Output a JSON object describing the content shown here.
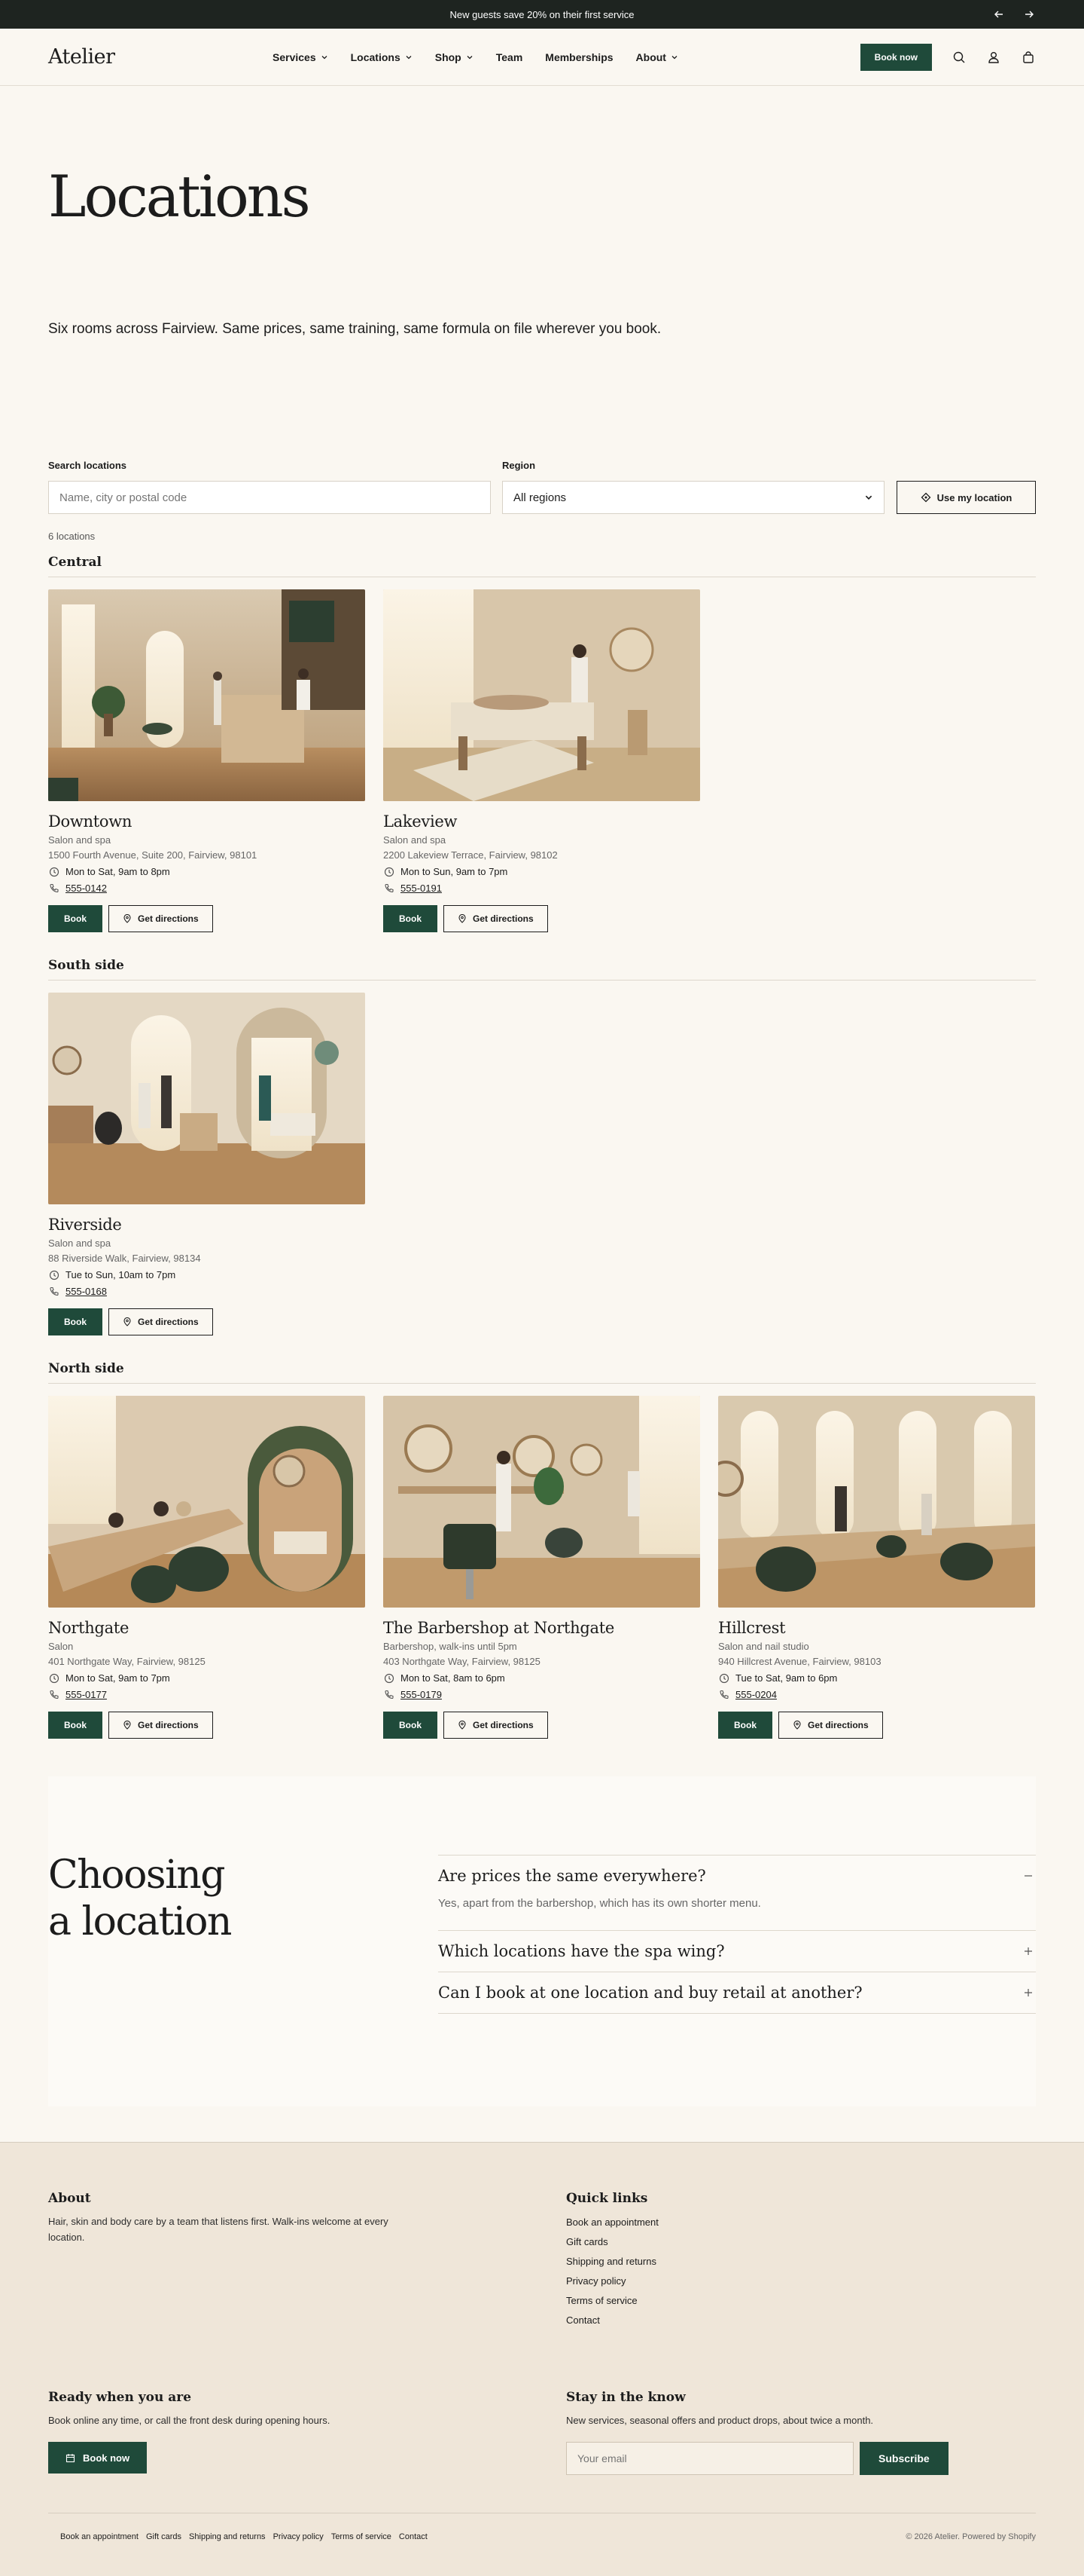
{
  "announcement": {
    "text": "New guests save 20% on their first service"
  },
  "header": {
    "logo": "Atelier",
    "nav": [
      {
        "label": "Services",
        "dropdown": true
      },
      {
        "label": "Locations",
        "dropdown": true
      },
      {
        "label": "Shop",
        "dropdown": true
      },
      {
        "label": "Team",
        "dropdown": false
      },
      {
        "label": "Memberships",
        "dropdown": false
      },
      {
        "label": "About",
        "dropdown": true
      }
    ],
    "book_label": "Book now"
  },
  "hero": {
    "title": "Locations",
    "subtitle": "Six rooms across Fairview. Same prices, same training, same formula on file wherever you book."
  },
  "search": {
    "search_label": "Search locations",
    "search_placeholder": "Name, city or postal code",
    "region_label": "Region",
    "region_value": "All regions",
    "use_location_label": "Use my location",
    "count": "6 locations"
  },
  "groups": [
    {
      "title": "Central",
      "locations": [
        {
          "name": "Downtown",
          "type": "Salon and spa",
          "address": "1500 Fourth Avenue, Suite 200, Fairview, 98101",
          "hours": "Mon to Sat, 9am to 8pm",
          "phone": "555-0142"
        },
        {
          "name": "Lakeview",
          "type": "Salon and spa",
          "address": "2200 Lakeview Terrace, Fairview, 98102",
          "hours": "Mon to Sun, 9am to 7pm",
          "phone": "555-0191"
        }
      ]
    },
    {
      "title": "South side",
      "locations": [
        {
          "name": "Riverside",
          "type": "Salon and spa",
          "address": "88 Riverside Walk, Fairview, 98134",
          "hours": "Tue to Sun, 10am to 7pm",
          "phone": "555-0168"
        }
      ]
    },
    {
      "title": "North side",
      "locations": [
        {
          "name": "Northgate",
          "type": "Salon",
          "address": "401 Northgate Way, Fairview, 98125",
          "hours": "Mon to Sat, 9am to 7pm",
          "phone": "555-0177"
        },
        {
          "name": "The Barbershop at Northgate",
          "type": "Barbershop, walk-ins until 5pm",
          "address": "403 Northgate Way, Fairview, 98125",
          "hours": "Mon to Sat, 8am to 6pm",
          "phone": "555-0179"
        },
        {
          "name": "Hillcrest",
          "type": "Salon and nail studio",
          "address": "940 Hillcrest Avenue, Fairview, 98103",
          "hours": "Tue to Sat, 9am to 6pm",
          "phone": "555-0204"
        }
      ]
    }
  ],
  "card_actions": {
    "book": "Book",
    "directions": "Get directions"
  },
  "faq": {
    "title_line1": "Choosing",
    "title_line2": "a location",
    "items": [
      {
        "question": "Are prices the same everywhere?",
        "answer": "Yes, apart from the barbershop, which has its own shorter menu.",
        "open": true
      },
      {
        "question": "Which locations have the spa wing?",
        "answer": "",
        "open": false
      },
      {
        "question": "Can I book at one location and buy retail at another?",
        "answer": "",
        "open": false
      }
    ]
  },
  "footer": {
    "about_title": "About",
    "about_text": "Hair, skin and body care by a team that listens first. Walk-ins welcome at every location.",
    "links_title": "Quick links",
    "links": [
      "Book an appointment",
      "Gift cards",
      "Shipping and returns",
      "Privacy policy",
      "Terms of service",
      "Contact"
    ],
    "ready_title": "Ready when you are",
    "ready_text": "Book online any time, or call the front desk during opening hours.",
    "ready_button": "Book now",
    "newsletter_title": "Stay in the know",
    "newsletter_text": "New services, seasonal offers and product drops, about twice a month.",
    "email_placeholder": "Your email",
    "subscribe_label": "Subscribe",
    "bottom_links": [
      "Book an appointment",
      "Gift cards",
      "Shipping and returns",
      "Privacy policy",
      "Terms of service",
      "Contact"
    ],
    "copyright": "© 2026 Atelier. Powered by Shopify"
  },
  "colors": {
    "accent": "#1f4a3a",
    "background": "#faf7f1",
    "footer": "#efe6d9",
    "announcement": "#1e2420"
  }
}
